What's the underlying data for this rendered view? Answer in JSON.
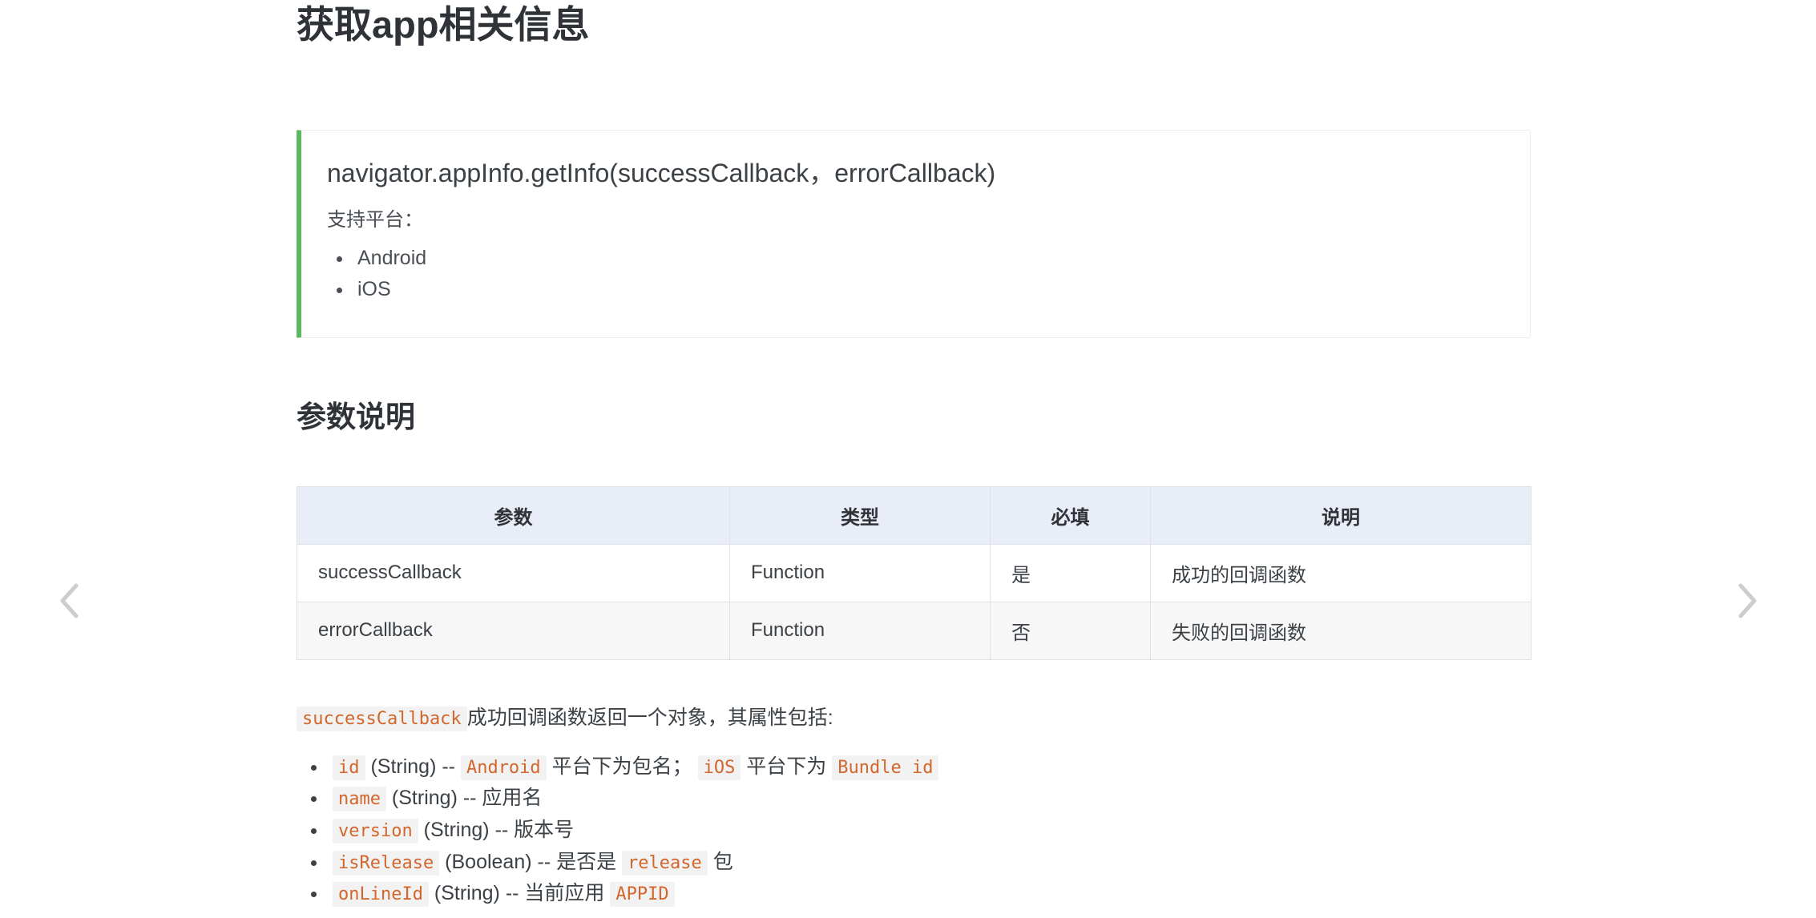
{
  "page": {
    "title": "获取app相关信息",
    "section_title": "参数说明"
  },
  "nav": {
    "prev_label": "prev",
    "next_label": "next"
  },
  "callout": {
    "signature": "navigator.appInfo.getInfo(successCallback，errorCallback)",
    "subtitle": "支持平台：",
    "platforms": [
      "Android",
      "iOS"
    ],
    "accent_color": "#5cb85c"
  },
  "table": {
    "headers": [
      "参数",
      "类型",
      "必填",
      "说明"
    ],
    "rows": [
      {
        "param": "successCallback",
        "type": "Function",
        "required": "是",
        "desc": "成功的回调函数"
      },
      {
        "param": "errorCallback",
        "type": "Function",
        "required": "否",
        "desc": "失败的回调函数"
      }
    ],
    "header_bg": "#e9edf7"
  },
  "callback_note": {
    "code": "successCallback",
    "text": "成功回调函数返回一个对象，其属性包括:"
  },
  "properties": [
    {
      "parts": [
        {
          "kind": "code",
          "text": "id"
        },
        {
          "kind": "text",
          "text": " (String) -- "
        },
        {
          "kind": "code",
          "text": "Android"
        },
        {
          "kind": "text",
          "text": " 平台下为包名； "
        },
        {
          "kind": "code",
          "text": "iOS"
        },
        {
          "kind": "text",
          "text": " 平台下为 "
        },
        {
          "kind": "code",
          "text": "Bundle id"
        }
      ]
    },
    {
      "parts": [
        {
          "kind": "code",
          "text": "name"
        },
        {
          "kind": "text",
          "text": " (String) -- 应用名"
        }
      ]
    },
    {
      "parts": [
        {
          "kind": "code",
          "text": "version"
        },
        {
          "kind": "text",
          "text": " (String) -- 版本号"
        }
      ]
    },
    {
      "parts": [
        {
          "kind": "code",
          "text": "isRelease"
        },
        {
          "kind": "text",
          "text": " (Boolean) -- 是否是 "
        },
        {
          "kind": "code",
          "text": "release"
        },
        {
          "kind": "text",
          "text": " 包"
        }
      ]
    },
    {
      "parts": [
        {
          "kind": "code",
          "text": "onLineId"
        },
        {
          "kind": "text",
          "text": " (String) -- 当前应用 "
        },
        {
          "kind": "code",
          "text": "APPID"
        }
      ]
    }
  ]
}
